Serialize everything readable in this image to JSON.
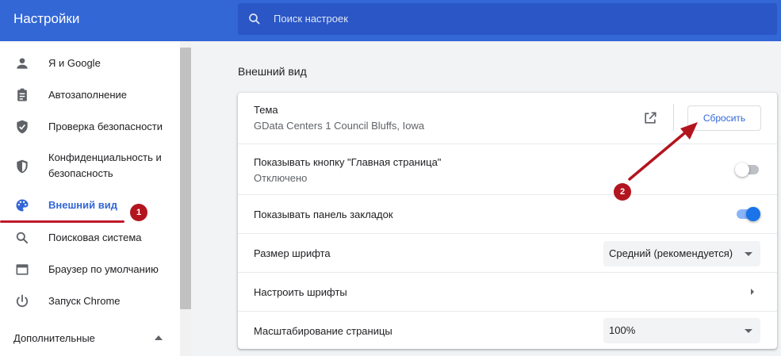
{
  "header": {
    "title": "Настройки",
    "search_placeholder": "Поиск настроек"
  },
  "sidebar": {
    "items": [
      {
        "label": "Я и Google",
        "icon": "person-icon",
        "active": false
      },
      {
        "label": "Автозаполнение",
        "icon": "clipboard-icon",
        "active": false
      },
      {
        "label": "Проверка безопасности",
        "icon": "shield-check-icon",
        "active": false
      },
      {
        "label": "Конфиденциальность и",
        "label2": "безопасность",
        "icon": "shield-icon",
        "active": false
      },
      {
        "label": "Внешний вид",
        "icon": "palette-icon",
        "active": true
      },
      {
        "label": "Поисковая система",
        "icon": "search-icon",
        "active": false
      },
      {
        "label": "Браузер по умолчанию",
        "icon": "browser-icon",
        "active": false
      },
      {
        "label": "Запуск Chrome",
        "icon": "power-icon",
        "active": false
      }
    ],
    "advanced_label": "Дополнительные"
  },
  "annotations": {
    "badge1": "1",
    "badge2": "2",
    "color": "#b3151f"
  },
  "main": {
    "section_title": "Внешний вид",
    "theme": {
      "label": "Тема",
      "value": "GData Centers 1 Council Bluffs, Iowa",
      "reset_label": "Сбросить"
    },
    "home_button": {
      "label": "Показывать кнопку \"Главная страница\"",
      "status": "Отключено",
      "enabled": false
    },
    "bookmarks_bar": {
      "label": "Показывать панель закладок",
      "enabled": true
    },
    "font_size": {
      "label": "Размер шрифта",
      "value": "Средний (рекомендуется)"
    },
    "customize_fonts": {
      "label": "Настроить шрифты"
    },
    "page_zoom": {
      "label": "Масштабирование страницы",
      "value": "100%"
    }
  },
  "colors": {
    "header_bg": "#3367d6",
    "accent": "#3367d6",
    "annotation": "#b3151f"
  }
}
